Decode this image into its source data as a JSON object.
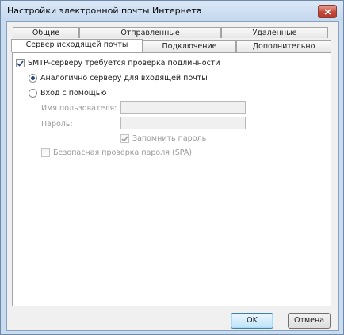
{
  "window": {
    "title": "Настройки электронной почты Интернета"
  },
  "tabs": {
    "row1": [
      "Общие",
      "Отправленные",
      "Удаленные"
    ],
    "row2": [
      "Сервер исходящей почты",
      "Подключение",
      "Дополнительно"
    ],
    "active": "Сервер исходящей почты"
  },
  "outgoing": {
    "smtp_auth": {
      "label": "SMTP-серверу требуется проверка подлинности",
      "checked": true
    },
    "same_as_incoming": {
      "label": "Аналогично серверу для входящей почты",
      "selected": true
    },
    "login_with": {
      "label": "Вход с помощью",
      "selected": false
    },
    "username": {
      "label": "Имя пользователя:",
      "value": ""
    },
    "password": {
      "label": "Пароль:",
      "value": ""
    },
    "remember_password": {
      "label": "Запомнить пароль",
      "checked": true
    },
    "spa": {
      "label": "Безопасная проверка пароля (SPA)",
      "checked": false
    }
  },
  "buttons": {
    "ok": "OK",
    "cancel": "Отмена"
  }
}
